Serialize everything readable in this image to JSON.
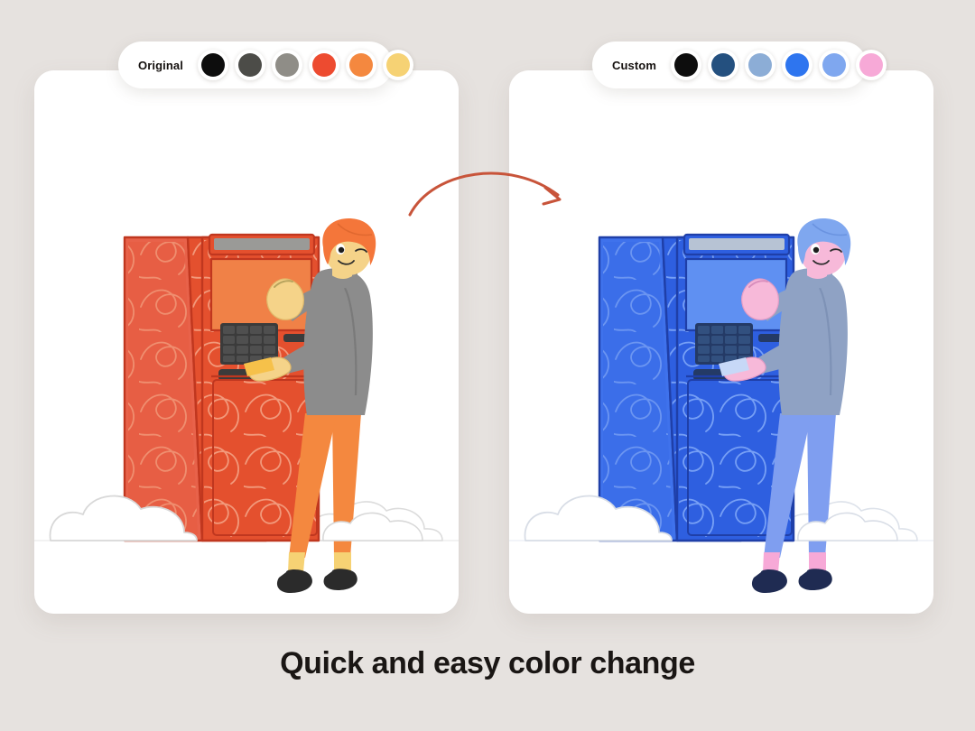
{
  "page": {
    "background_color": "#e6e2df",
    "caption": "Quick and easy color change"
  },
  "arrow": {
    "name": "curved-arrow-left-to-right",
    "color": "#c8543a",
    "direction": "left-to-right"
  },
  "palettes": [
    {
      "id": "original",
      "label": "Original",
      "swatches": [
        {
          "name": "black",
          "hex": "#0d0d0d"
        },
        {
          "name": "dark-gray",
          "hex": "#4c4c48"
        },
        {
          "name": "mid-gray",
          "hex": "#8f8d87"
        },
        {
          "name": "red-orange",
          "hex": "#ed4b30"
        },
        {
          "name": "orange",
          "hex": "#f4883f"
        },
        {
          "name": "yellow",
          "hex": "#f6d274"
        }
      ]
    },
    {
      "id": "custom",
      "label": "Custom",
      "swatches": [
        {
          "name": "black",
          "hex": "#0d0d0d"
        },
        {
          "name": "navy-blue",
          "hex": "#24507f"
        },
        {
          "name": "steel-blue",
          "hex": "#8cadd6"
        },
        {
          "name": "bright-blue",
          "hex": "#2e75ef"
        },
        {
          "name": "light-blue",
          "hex": "#7fa7ef"
        },
        {
          "name": "pink",
          "hex": "#f7a9d7"
        }
      ]
    }
  ],
  "illustrations": [
    {
      "id": "original-illustration",
      "title": "Person using ATM kiosk - original orange colorway",
      "colors": {
        "kiosk_body": "#e4502e",
        "kiosk_body_dark": "#d6472a",
        "kiosk_side": "#e8624a",
        "kiosk_outline": "#c0371f",
        "screen": "#f08147",
        "screen_top_strip": "#9a9a97",
        "keypad": "#3b3b3b",
        "keypad_key": "#4a4a4a",
        "slot": "#3b3b3b",
        "texture_line": "#f3a183",
        "hair": "#f4763a",
        "skin": "#f5d389",
        "sweater": "#8c8c8c",
        "sweater_dark": "#7a7a7a",
        "pants": "#f4883f",
        "sock": "#f6d274",
        "shoe": "#2b2b2b",
        "cloud_fill": "#ffffff",
        "cloud_outline": "#d8d8d8",
        "money": "#f6c14a"
      }
    },
    {
      "id": "custom-illustration",
      "title": "Person using ATM kiosk - custom blue colorway",
      "colors": {
        "kiosk_body": "#2e5fe0",
        "kiosk_body_dark": "#2a55cf",
        "kiosk_side": "#3f72ec",
        "kiosk_outline": "#1f3fa8",
        "screen": "#5f90f2",
        "screen_top_strip": "#b7c3d4",
        "keypad": "#243a66",
        "keypad_key": "#2f4a7d",
        "slot": "#243a66",
        "texture_line": "#7ea6f7",
        "hair": "#7fa7ef",
        "skin": "#f7b9d9",
        "sweater": "#8fa2c4",
        "sweater_dark": "#7e92b6",
        "pants": "#7f9ef0",
        "sock": "#f7a9d7",
        "shoe": "#1f2b52",
        "cloud_fill": "#ffffff",
        "cloud_outline": "#d8dde6",
        "money": "#c7d8f7"
      }
    }
  ]
}
